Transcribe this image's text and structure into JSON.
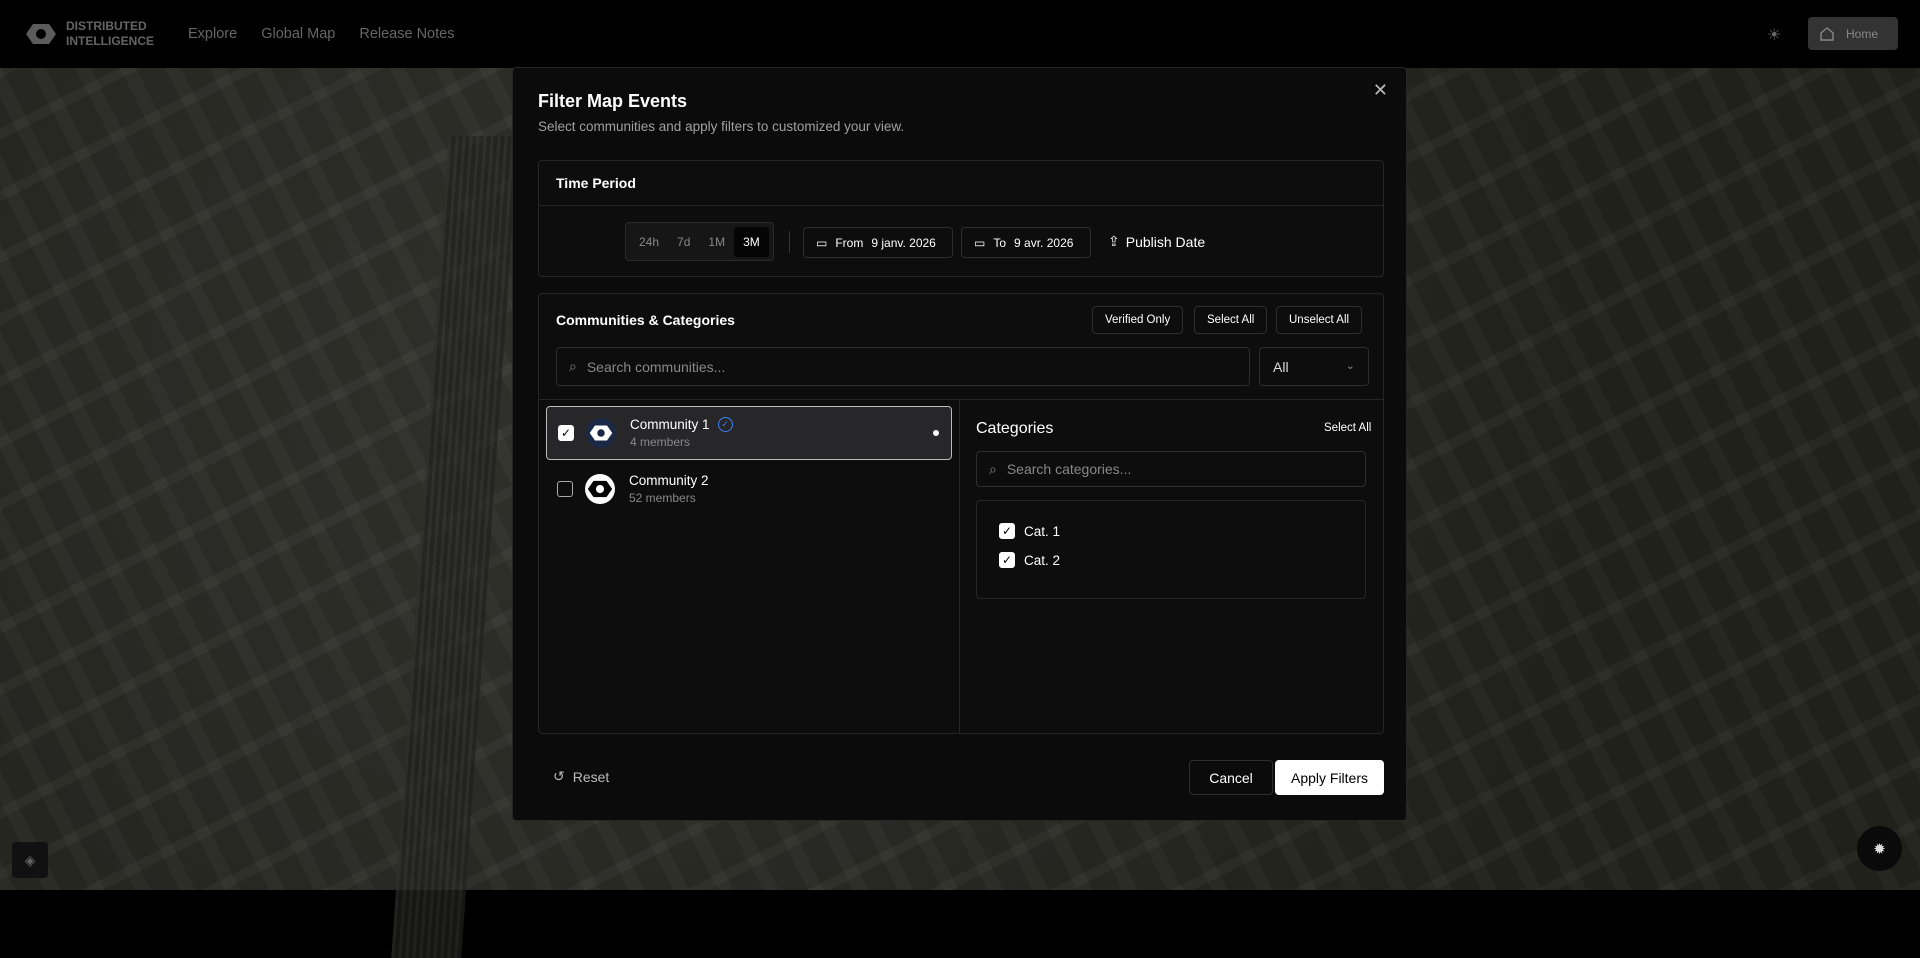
{
  "header": {
    "brand_line1": "DISTRIBUTED",
    "brand_line2": "INTELLIGENCE",
    "nav": [
      "Explore",
      "Global Map",
      "Release Notes"
    ],
    "home_label": "Home"
  },
  "modal": {
    "title": "Filter Map Events",
    "subtitle": "Select communities and apply filters to customized your view.",
    "time_period": {
      "heading": "Time Period",
      "ranges": [
        "24h",
        "7d",
        "1M",
        "3M"
      ],
      "active_range": "3M",
      "from_label": "From",
      "from_value": "9 janv. 2026",
      "to_label": "To",
      "to_value": "9 avr. 2026",
      "publish_label": "Publish Date"
    },
    "communities": {
      "heading": "Communities & Categories",
      "verified_only": "Verified Only",
      "select_all": "Select All",
      "unselect_all": "Unselect All",
      "search_placeholder": "Search communities...",
      "filter_value": "All",
      "items": [
        {
          "name": "Community 1",
          "members": "4 members",
          "checked": true,
          "verified": true
        },
        {
          "name": "Community 2",
          "members": "52 members",
          "checked": false,
          "verified": false
        }
      ]
    },
    "categories": {
      "heading": "Categories",
      "select_all": "Select All",
      "search_placeholder": "Search categories...",
      "items": [
        {
          "name": "Cat. 1",
          "checked": true
        },
        {
          "name": "Cat. 2",
          "checked": true
        }
      ]
    },
    "footer": {
      "reset": "Reset",
      "cancel": "Cancel",
      "apply": "Apply Filters"
    }
  },
  "colors": {
    "verified": "#3b82f6",
    "modal_bg": "#0b0b0c"
  }
}
